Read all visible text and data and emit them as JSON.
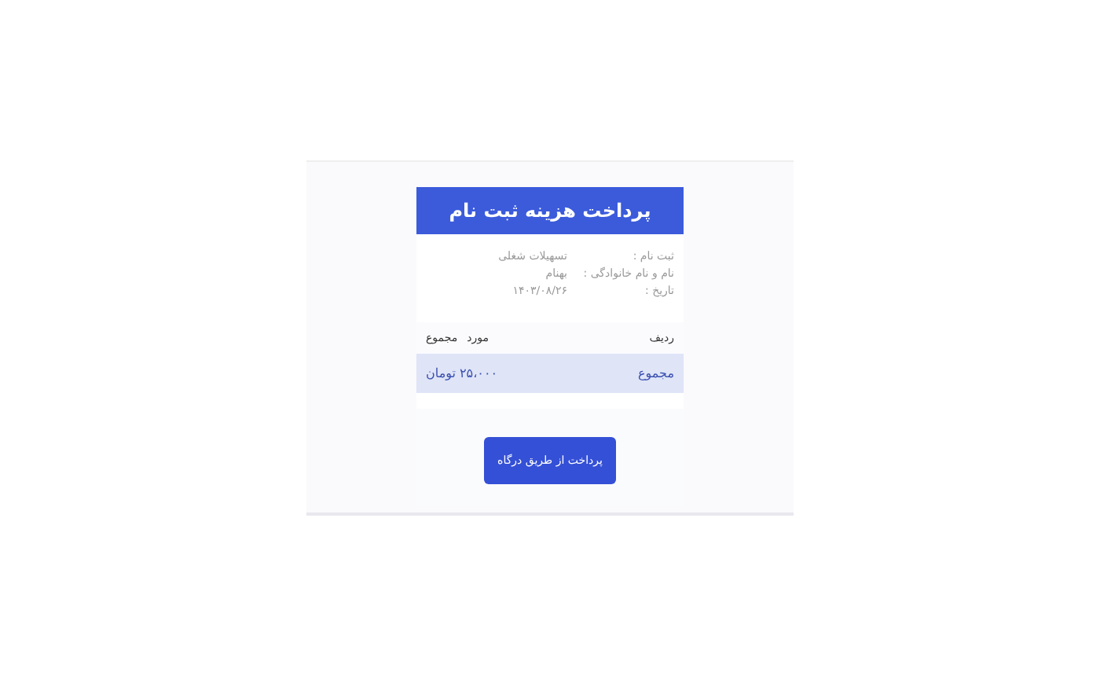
{
  "header": {
    "title": "پرداخت هزینه ثبت نام"
  },
  "details": [
    {
      "label": "ثبت نام :",
      "value": "تسهیلات شغلی"
    },
    {
      "label": "نام و نام خانوادگی :",
      "value": "بهنام"
    },
    {
      "label": "تاریخ :",
      "value": "۱۴۰۳/۰۸/۲۶"
    }
  ],
  "table": {
    "columns": [
      "ردیف",
      "مورد",
      "مجموع"
    ],
    "rows": [
      {
        "label": "مجموع",
        "amount": "۲۵،۰۰۰ تومان"
      }
    ]
  },
  "pay_button": "پرداخت از طریق درگاه"
}
